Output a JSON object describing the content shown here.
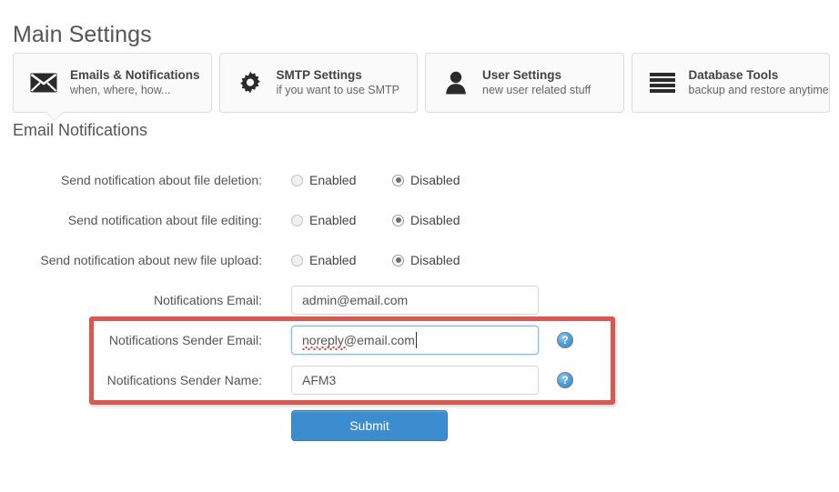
{
  "page": {
    "title": "Main Settings",
    "section_heading": "Email Notifications"
  },
  "tabs": [
    {
      "id": "emails-notifications",
      "icon": "envelope-icon",
      "title": "Emails & Notifications",
      "subtitle": "when, where, how...",
      "active": true
    },
    {
      "id": "smtp-settings",
      "icon": "gear-icon",
      "title": "SMTP Settings",
      "subtitle": "if you want to use SMTP",
      "active": false
    },
    {
      "id": "user-settings",
      "icon": "user-icon",
      "title": "User Settings",
      "subtitle": "new user related stuff",
      "active": false
    },
    {
      "id": "database-tools",
      "icon": "database-lines-icon",
      "title": "Database Tools",
      "subtitle": "backup and restore anytime",
      "active": false
    }
  ],
  "form": {
    "radio_rows": [
      {
        "label": "Send notification about file deletion:",
        "enabled_label": "Enabled",
        "disabled_label": "Disabled",
        "selected": "Disabled"
      },
      {
        "label": "Send notification about file editing:",
        "enabled_label": "Enabled",
        "disabled_label": "Disabled",
        "selected": "Disabled"
      },
      {
        "label": "Send notification about new file upload:",
        "enabled_label": "Enabled",
        "disabled_label": "Disabled",
        "selected": "Disabled"
      }
    ],
    "notifications_email": {
      "label": "Notifications Email:",
      "value": "admin@email.com",
      "focused": false,
      "has_help": false
    },
    "sender_email": {
      "label": "Notifications Sender Email:",
      "value": "noreply@email.com",
      "focused": true,
      "has_help": true,
      "help_label": "?"
    },
    "sender_name": {
      "label": "Notifications Sender Name:",
      "value": "AFM3",
      "focused": false,
      "has_help": true,
      "help_label": "?"
    },
    "submit_label": "Submit"
  },
  "colors": {
    "highlight_border": "#e0564c",
    "submit_background": "#3b8dd0",
    "focus_border": "#7fb9e8",
    "help_icon": "#4ea3e0",
    "text": "#555555"
  }
}
